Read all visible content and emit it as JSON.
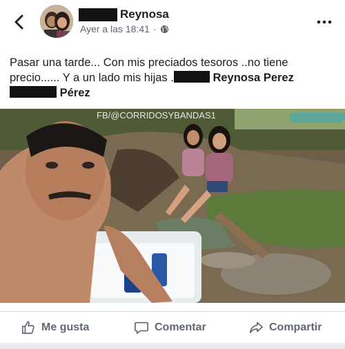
{
  "header": {
    "author_name": "Reynosa",
    "timestamp": "Ayer a las 18:41",
    "separator": "·",
    "audience_icon": "globe-icon",
    "back_icon": "chevron-left-icon",
    "more_icon": "more-horizontal-icon"
  },
  "post": {
    "line1": "Pasar una tarde... Con mis preciados  tesoros ..no tiene",
    "line2_start": "precio...... Y a un lado mis hijas .",
    "line2_name": "Reynosa Perez",
    "line3_name": "Pérez"
  },
  "photo": {
    "watermark": "FB/@CORRIDOSYBANDAS1"
  },
  "actions": {
    "like_label": "Me gusta",
    "comment_label": "Comentar",
    "share_label": "Compartir"
  },
  "colors": {
    "text": "#1c1e21",
    "secondary": "#606770",
    "divider": "#dadde1"
  }
}
